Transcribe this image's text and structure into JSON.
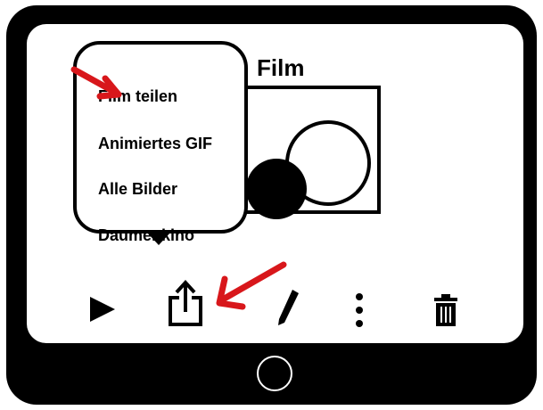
{
  "content": {
    "film_title": "Film"
  },
  "share_menu": {
    "items": [
      {
        "label": "Film teilen"
      },
      {
        "label": "Animiertes GIF"
      },
      {
        "label": "Alle Bilder"
      },
      {
        "label": "Daumenkino"
      }
    ]
  },
  "toolbar": {
    "buttons": [
      {
        "icon": "play-icon"
      },
      {
        "icon": "share-icon"
      },
      {
        "icon": "pencil-icon"
      },
      {
        "icon": "more-vertical-icon"
      },
      {
        "icon": "trash-icon"
      }
    ]
  },
  "device": {
    "home_button_icon": "home-button-circle"
  },
  "annotations": {
    "arrow_color": "#d8171b"
  },
  "colors": {
    "bezel": "#000000",
    "screen": "#ffffff",
    "text": "#000000"
  }
}
